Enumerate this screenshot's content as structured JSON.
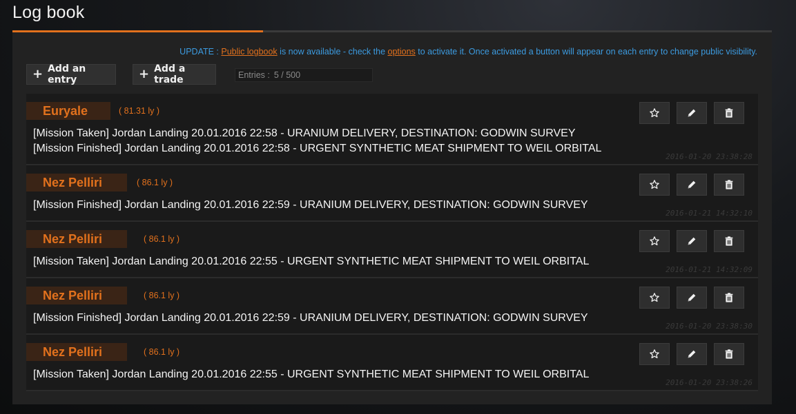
{
  "header": {
    "title": "Log book"
  },
  "notice": {
    "prefix": "UPDATE : ",
    "link1": "Public logbook",
    "mid": " is now available - check the ",
    "link2": "options",
    "suffix": " to activate it. Once activated a button will appear on each entry to change public visibility."
  },
  "toolbar": {
    "add_entry_label": "Add an entry",
    "add_trade_label": "Add a trade",
    "entries_label": "Entries :",
    "entries_value": "5 / 500"
  },
  "entries": [
    {
      "system": "Euryale",
      "distance": "( 81.31 ly )",
      "lines": [
        "[Mission Taken] Jordan Landing 20.01.2016 22:58 - URANIUM DELIVERY, DESTINATION: GODWIN SURVEY",
        "[Mission Finished] Jordan Landing 20.01.2016 22:58 - URGENT SYNTHETIC MEAT SHIPMENT TO WEIL ORBITAL"
      ],
      "timestamp": "2016-01-20 23:38:28"
    },
    {
      "system": "Nez Pelliri",
      "distance": "( 86.1 ly )",
      "lines": [
        "[Mission Finished] Jordan Landing 20.01.2016 22:59 - URANIUM DELIVERY, DESTINATION: GODWIN SURVEY"
      ],
      "timestamp": "2016-01-21 14:32:10"
    },
    {
      "system": "Nez Pelliri",
      "distance": "( 86.1 ly )",
      "lines": [
        "[Mission Taken] Jordan Landing 20.01.2016 22:55 - URGENT SYNTHETIC MEAT SHIPMENT TO WEIL ORBITAL"
      ],
      "timestamp": "2016-01-21 14:32:09"
    },
    {
      "system": "Nez Pelliri",
      "distance": "( 86.1 ly )",
      "lines": [
        "[Mission Finished] Jordan Landing 20.01.2016 22:59 - URANIUM DELIVERY, DESTINATION: GODWIN SURVEY"
      ],
      "timestamp": "2016-01-20 23:38:30"
    },
    {
      "system": "Nez Pelliri",
      "distance": "( 86.1 ly )",
      "lines": [
        "[Mission Taken] Jordan Landing 20.01.2016 22:55 - URGENT SYNTHETIC MEAT SHIPMENT TO WEIL ORBITAL"
      ],
      "timestamp": "2016-01-20 23:38:26"
    }
  ],
  "icons": {
    "favorite": "star-icon",
    "edit": "pencil-icon",
    "delete": "trash-icon"
  },
  "colors": {
    "accent": "#e2711d",
    "link": "#3c9be0"
  }
}
